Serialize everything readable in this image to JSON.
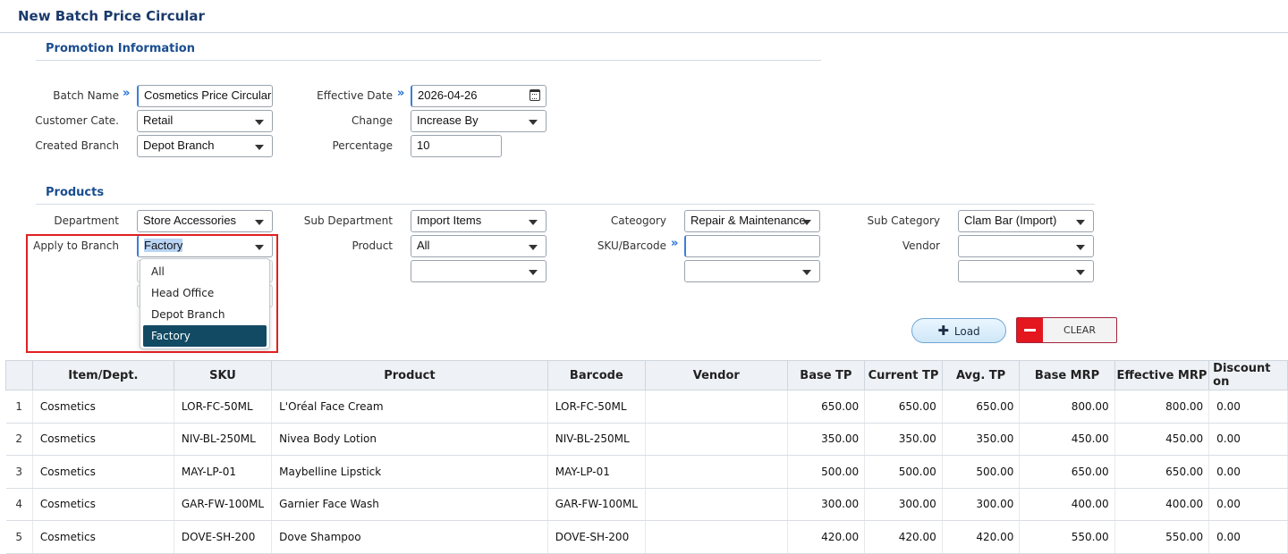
{
  "page_title": "New Batch Price Circular",
  "promotion": {
    "section_title": "Promotion Information",
    "batch_name_label": "Batch Name",
    "batch_name_value": "Cosmetics Price Circular",
    "customer_cate_label": "Customer Cate.",
    "customer_cate_value": "Retail",
    "created_branch_label": "Created Branch",
    "created_branch_value": "Depot Branch",
    "effective_date_label": "Effective Date",
    "effective_date_value": "2026-04-26",
    "change_label": "Change",
    "change_value": "Increase By",
    "percentage_label": "Percentage",
    "percentage_value": "10"
  },
  "products": {
    "section_title": "Products",
    "department_label": "Department",
    "department_value": "Store Accessories",
    "apply_branch_label": "Apply to Branch",
    "apply_branch_value": "Factory",
    "sub_department_label": "Sub Department",
    "sub_department_value": "Import Items",
    "product_label": "Product",
    "product_value": "All",
    "category_label": "Cateogory",
    "category_value": "Repair & Maintenance",
    "sku_label": "SKU/Barcode",
    "sku_value": "",
    "sub_category_label": "Sub Category",
    "sub_category_value": "Clam Bar (Import)",
    "vendor_label": "Vendor",
    "vendor_value": ""
  },
  "branch_dropdown": {
    "options": [
      "All",
      "Head Office",
      "Depot Branch",
      "Factory"
    ],
    "selected": "Factory"
  },
  "buttons": {
    "load": "Load",
    "clear": "CLEAR"
  },
  "table": {
    "headers": [
      "",
      "Item/Dept.",
      "SKU",
      "Product",
      "Barcode",
      "Vendor",
      "Base TP",
      "Current TP",
      "Avg. TP",
      "Base MRP",
      "Effective MRP",
      "Discount on"
    ],
    "rows": [
      [
        "1",
        "Cosmetics",
        "LOR-FC-50ML",
        "L'Oréal Face Cream",
        "LOR-FC-50ML",
        "",
        "650.00",
        "650.00",
        "650.00",
        "800.00",
        "800.00",
        "0.00"
      ],
      [
        "2",
        "Cosmetics",
        "NIV-BL-250ML",
        "Nivea Body Lotion",
        "NIV-BL-250ML",
        "",
        "350.00",
        "350.00",
        "350.00",
        "450.00",
        "450.00",
        "0.00"
      ],
      [
        "3",
        "Cosmetics",
        "MAY-LP-01",
        "Maybelline Lipstick",
        "MAY-LP-01",
        "",
        "500.00",
        "500.00",
        "500.00",
        "650.00",
        "650.00",
        "0.00"
      ],
      [
        "4",
        "Cosmetics",
        "GAR-FW-100ML",
        "Garnier Face Wash",
        "GAR-FW-100ML",
        "",
        "300.00",
        "300.00",
        "300.00",
        "400.00",
        "400.00",
        "0.00"
      ],
      [
        "5",
        "Cosmetics",
        "DOVE-SH-200",
        "Dove Shampoo",
        "DOVE-SH-200",
        "",
        "420.00",
        "420.00",
        "420.00",
        "550.00",
        "550.00",
        "0.00"
      ]
    ]
  }
}
